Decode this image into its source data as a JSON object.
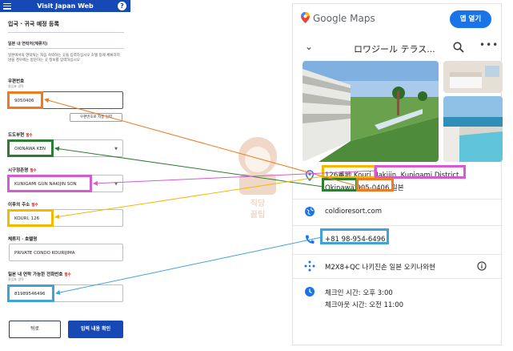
{
  "vjw": {
    "header_title": "Visit Japan Web",
    "help": "?",
    "section_title": "입국 · 귀국 예정 등록",
    "subsection": "일본 내 연락처(체류지)",
    "description": "일본에서의 연락처는 처음 숙박하는 곳을 입력하십시오 호텔 등에 체류하지 않을 경우에는 방문하는 곳 정보를 입력하십시오",
    "zip": {
      "label": "우편번호",
      "hint": "물입표 생략",
      "value": "9050406",
      "lookup_button": "우편번호로 자동 입력"
    },
    "prefecture": {
      "label": "도도부현",
      "required": "필수",
      "value": "OKINAWA KEN"
    },
    "city": {
      "label": "시구정촌명",
      "required": "필수",
      "value": "KUNIGAMI GUN NAKIJIN SON"
    },
    "address": {
      "label": "이후의 주소",
      "required": "필수",
      "value": "KOURI, 126"
    },
    "hotel": {
      "label": "체류지 · 호텔명",
      "value": "PRIVATE CONDO KOURIJIMA"
    },
    "phone": {
      "label": "일본 내 연락 가능한 전화번호",
      "required": "필수",
      "hint": "물입표 생략",
      "value": "81989546496"
    },
    "back_button": "뒤로",
    "confirm_button": "입력 내용 확인"
  },
  "maps": {
    "logo": "Google Maps",
    "open_app": "앱 열기",
    "place_name": "ロワジール テラス...",
    "more": "•••",
    "address_line1_parts": [
      "126番地",
      " Kouri",
      " Nakijin, Kunigami District,"
    ],
    "address_line2_parts": [
      "Okinawa",
      " 905-0406",
      " 일본"
    ],
    "website": "coldioresort.com",
    "phone": "+81 98-954-6496",
    "plus_code": "M2X8+QC 나키진손 일본 오키나와현",
    "checkin": "체크인 시간: 오후 3:00",
    "checkout": "체크아웃 시간: 오전 11:00"
  },
  "watermark": {
    "line1": "직당",
    "line2": "꿀팁"
  },
  "colors": {
    "vjw_blue": "#1749b6",
    "maps_blue": "#1a73e8",
    "hl_orange": "#ee7a21",
    "hl_green": "#2e7d32",
    "hl_pink": "#d45bd0",
    "hl_yellow": "#f5b800",
    "hl_cyan": "#3fa3d8"
  },
  "icons": [
    "menu-icon",
    "help-icon",
    "chevron-down-icon",
    "maps-pin-icon",
    "search-icon",
    "more-icon",
    "location-icon",
    "globe-icon",
    "phone-icon",
    "plus-code-icon",
    "info-icon",
    "clock-icon"
  ]
}
